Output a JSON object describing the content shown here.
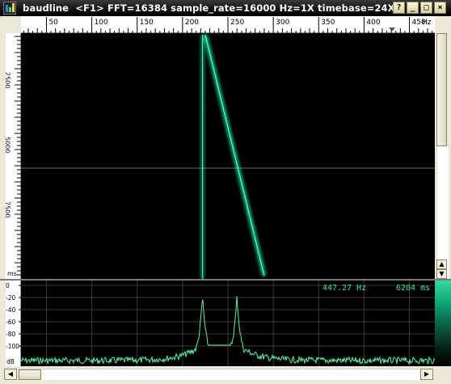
{
  "window": {
    "app_name": "baudline",
    "title_rest": "<F1> FFT=16384 sample_rate=16000 Hz=1X timebase=24X",
    "buttons": {
      "help": "?",
      "minimize": "_",
      "maximize": "□",
      "close": "×"
    }
  },
  "freq_axis": {
    "labels": [
      "50",
      "100",
      "150",
      "200",
      "250",
      "300",
      "350",
      "400",
      "450"
    ],
    "values": [
      50,
      100,
      150,
      200,
      250,
      300,
      350,
      400,
      450
    ],
    "unit": "Hz",
    "range_hz": [
      22,
      478
    ]
  },
  "time_axis": {
    "labels": [
      "2500",
      "5000",
      "7500"
    ],
    "unit": "ms"
  },
  "spectrogram": {
    "background": "#000000",
    "trace_color": "#19c98e",
    "steady_tone_hz": 222,
    "sweep_start_hz": 225,
    "sweep_end_hz": 290
  },
  "spectrum": {
    "db_labels": [
      "0",
      "-20",
      "-40",
      "-60",
      "-80",
      "-100"
    ],
    "db_unit": "dB",
    "trace_color": "#5df0a8",
    "peaks_hz": [
      222,
      260
    ]
  },
  "readout": {
    "frequency": "447.27 Hz",
    "time": "6204 ms"
  },
  "colors": {
    "accent_green": "#3fe0a0",
    "title_bar": "#111111"
  }
}
